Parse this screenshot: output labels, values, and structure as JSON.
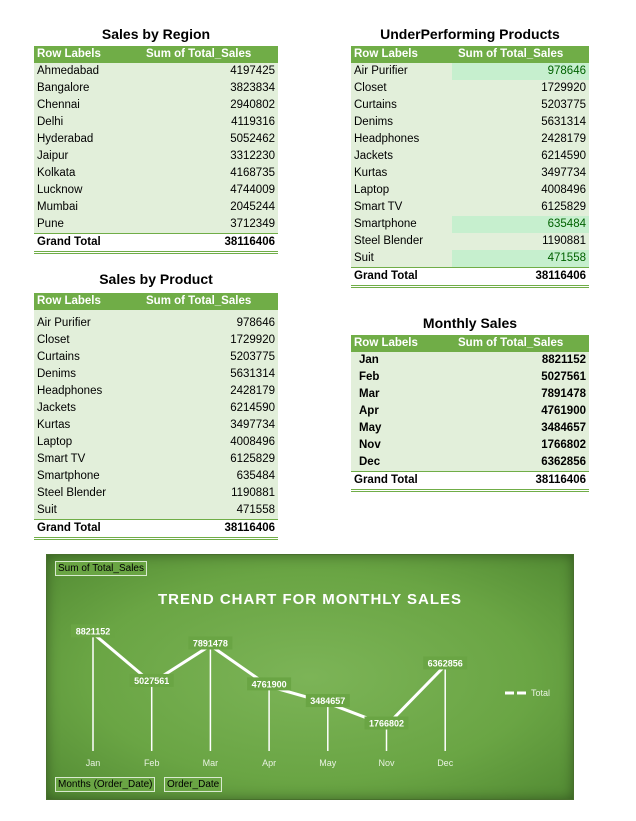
{
  "region": {
    "title": "Sales by Region",
    "header": {
      "label": "Row Labels",
      "value": "Sum of Total_Sales"
    },
    "rows": [
      {
        "label": "Ahmedabad",
        "value": "4197425"
      },
      {
        "label": "Bangalore",
        "value": "3823834"
      },
      {
        "label": "Chennai",
        "value": "2940802"
      },
      {
        "label": "Delhi",
        "value": "4119316"
      },
      {
        "label": "Hyderabad",
        "value": "5052462"
      },
      {
        "label": "Jaipur",
        "value": "3312230"
      },
      {
        "label": "Kolkata",
        "value": "4168735"
      },
      {
        "label": "Lucknow",
        "value": "4744009"
      },
      {
        "label": "Mumbai",
        "value": "2045244"
      },
      {
        "label": "Pune",
        "value": "3712349"
      }
    ],
    "total": {
      "label": "Grand Total",
      "value": "38116406"
    }
  },
  "underperforming": {
    "title": "UnderPerforming Products",
    "header": {
      "label": "Row Labels",
      "value": "Sum of Total_Sales"
    },
    "rows": [
      {
        "label": "Air Purifier",
        "value": "978646",
        "highlight": true
      },
      {
        "label": "Closet",
        "value": "1729920"
      },
      {
        "label": "Curtains",
        "value": "5203775"
      },
      {
        "label": "Denims",
        "value": "5631314"
      },
      {
        "label": "Headphones",
        "value": "2428179"
      },
      {
        "label": "Jackets",
        "value": "6214590"
      },
      {
        "label": "Kurtas",
        "value": "3497734"
      },
      {
        "label": "Laptop",
        "value": "4008496"
      },
      {
        "label": "Smart TV",
        "value": "6125829"
      },
      {
        "label": "Smartphone",
        "value": "635484",
        "highlight": true
      },
      {
        "label": "Steel Blender",
        "value": "1190881"
      },
      {
        "label": "Suit",
        "value": "471558",
        "highlight": true
      }
    ],
    "total": {
      "label": "Grand Total",
      "value": "38116406"
    }
  },
  "product": {
    "title": "Sales by Product",
    "header": {
      "label": "Row Labels",
      "value": "Sum of Total_Sales"
    },
    "rows": [
      {
        "label": "Air Purifier",
        "value": "978646"
      },
      {
        "label": "Closet",
        "value": "1729920"
      },
      {
        "label": "Curtains",
        "value": "5203775"
      },
      {
        "label": "Denims",
        "value": "5631314"
      },
      {
        "label": "Headphones",
        "value": "2428179"
      },
      {
        "label": "Jackets",
        "value": "6214590"
      },
      {
        "label": "Kurtas",
        "value": "3497734"
      },
      {
        "label": "Laptop",
        "value": "4008496"
      },
      {
        "label": "Smart TV",
        "value": "6125829"
      },
      {
        "label": "Smartphone",
        "value": "635484"
      },
      {
        "label": "Steel Blender",
        "value": "1190881"
      },
      {
        "label": "Suit",
        "value": "471558"
      }
    ],
    "total": {
      "label": "Grand Total",
      "value": "38116406"
    }
  },
  "monthly": {
    "title": "Monthly Sales",
    "header": {
      "label": "Row Labels",
      "value": "Sum of Total_Sales"
    },
    "rows": [
      {
        "label": "Jan",
        "value": "8821152"
      },
      {
        "label": "Feb",
        "value": "5027561"
      },
      {
        "label": "Mar",
        "value": "7891478"
      },
      {
        "label": "Apr",
        "value": "4761900"
      },
      {
        "label": "May",
        "value": "3484657"
      },
      {
        "label": "Nov",
        "value": "1766802"
      },
      {
        "label": "Dec",
        "value": "6362856"
      }
    ],
    "total": {
      "label": "Grand Total",
      "value": "38116406"
    }
  },
  "chart_ui": {
    "value_field_button": "Sum of Total_Sales",
    "axis_field_buttons": [
      "Months (Order_Date)",
      "Order_Date"
    ]
  },
  "colors": {
    "accent": "#70ad47",
    "row_fill": "#e2efda",
    "highlight_fill": "#c6efce",
    "highlight_text": "#006100"
  },
  "chart_data": {
    "type": "line",
    "title": "TREND CHART FOR MONTHLY SALES",
    "categories": [
      "Jan",
      "Feb",
      "Mar",
      "Apr",
      "May",
      "Nov",
      "Dec"
    ],
    "series": [
      {
        "name": "Total",
        "values": [
          8821152,
          5027561,
          7891478,
          4761900,
          3484657,
          1766802,
          6362856
        ]
      }
    ],
    "data_labels": true,
    "grid": false,
    "legend": "right",
    "drop_lines": true
  }
}
